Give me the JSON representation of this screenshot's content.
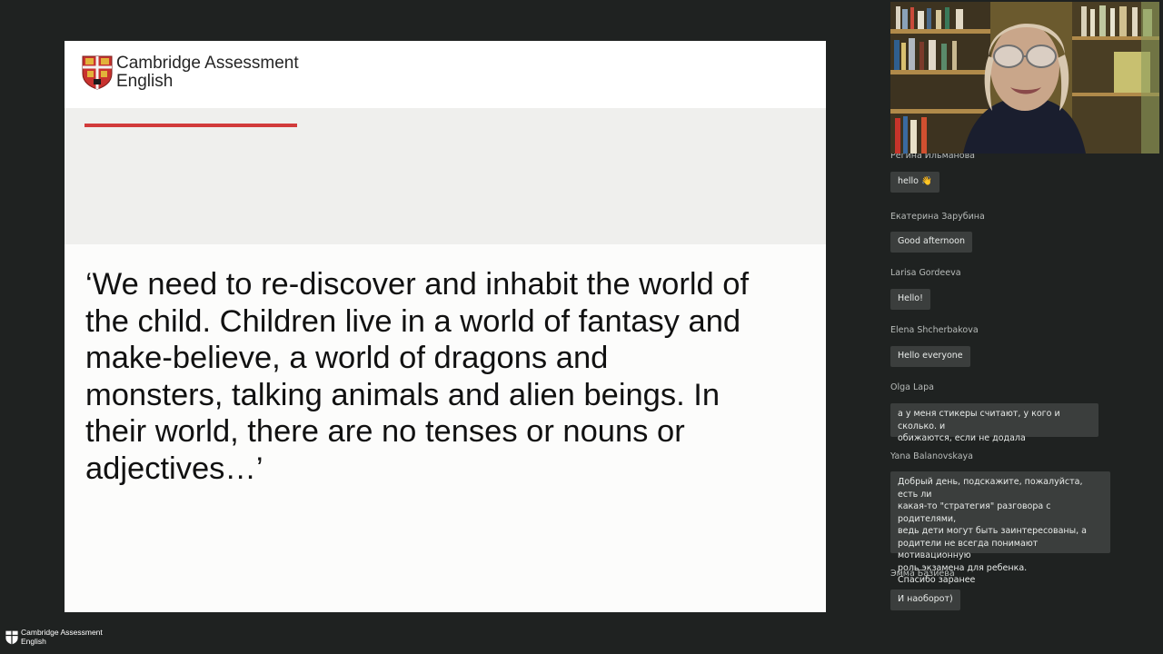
{
  "slide": {
    "logo_line1": "Cambridge Assessment",
    "logo_line2": "English",
    "quote": "‘We need to re-discover and inhabit the world of\nthe child. Children live in a world of fantasy and\nmake-believe, a world of dragons and\nmonsters, talking animals and alien beings. In\ntheir world, there are no tenses or nouns or\nadjectives…’"
  },
  "chat": {
    "messages": [
      {
        "sender": "Регина Ильманова",
        "text": "hello 👋"
      },
      {
        "sender": "Екатерина Зарубина",
        "text": "Good afternoon"
      },
      {
        "sender": "Larisa Gordeeva",
        "text": "Hello!"
      },
      {
        "sender": "Elena Shcherbakova",
        "text": "Hello everyone"
      },
      {
        "sender": "Olga Lapa",
        "text": "а у меня стикеры считают, у кого и сколько. и\nобижаются, если не додала"
      },
      {
        "sender": "Yana Balanovskaya",
        "text": "Добрый день, подскажите, пожалуйста, есть ли\nкакая-то \"стратегия\" разговора с родителями,\nведь дети могут быть заинтересованы, а\nродители не всегда понимают мотивационную\nроль экзамена для ребенка.\nСпасибо заранее"
      },
      {
        "sender": "Эмма Базиева",
        "text": "И наоборот)"
      }
    ]
  },
  "footer": {
    "logo_line1": "Cambridge Assessment",
    "logo_line2": "English"
  },
  "colors": {
    "background": "#1f2221",
    "slide_accent": "#d23b3b",
    "bubble": "#3b3e3d"
  }
}
